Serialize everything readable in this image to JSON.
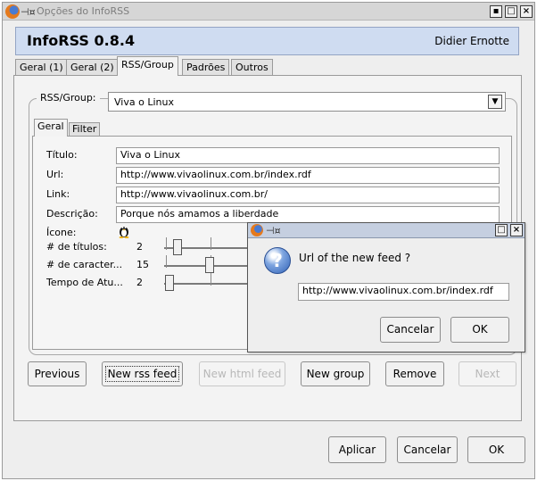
{
  "window": {
    "title": "Opções do InfoRSS"
  },
  "header": {
    "app_name": "InfoRSS 0.8.4",
    "author": "Didier Ernotte"
  },
  "tabs": [
    {
      "label": "Geral (1)"
    },
    {
      "label": "Geral (2)"
    },
    {
      "label": "RSS/Group"
    },
    {
      "label": "Padrões"
    },
    {
      "label": "Outros"
    }
  ],
  "rss_group": {
    "label": "RSS/Group:",
    "selected": "Viva o Linux"
  },
  "subtabs": [
    {
      "label": "Geral"
    },
    {
      "label": "Filter"
    }
  ],
  "form": {
    "titulo": {
      "label": "Título:",
      "value": "Viva o Linux"
    },
    "url": {
      "label": "Url:",
      "value": "http://www.vivaolinux.com.br/index.rdf"
    },
    "link": {
      "label": "Link:",
      "value": "http://www.vivaolinux.com.br/"
    },
    "descricao": {
      "label": "Descrição:",
      "value": "Porque nós amamos a liberdade"
    },
    "icone": {
      "label": "Ícone:",
      "icon": "tux-penguin-icon"
    }
  },
  "sliders": [
    {
      "label": "# de títulos:",
      "value": "2"
    },
    {
      "label": "# de caracter...",
      "value": "15"
    },
    {
      "label": "Tempo de Atu...",
      "value": "2"
    }
  ],
  "action_buttons": {
    "previous": "Previous",
    "new_rss_feed": "New rss feed",
    "new_html_feed": "New html feed",
    "new_group": "New group",
    "remove": "Remove",
    "next": "Next"
  },
  "footer_buttons": {
    "apply": "Aplicar",
    "cancel": "Cancelar",
    "ok": "OK"
  },
  "dialog": {
    "prompt": "Url of the new feed ?",
    "input_value": "http://www.vivaolinux.com.br/index.rdf",
    "cancel": "Cancelar",
    "ok": "OK"
  },
  "titlebar_buttons": {
    "minimize": "▪",
    "maximize": "□",
    "close": "×"
  },
  "colors": {
    "header_bg": "#cfdcf1",
    "active_title": "#c5cfe0"
  }
}
